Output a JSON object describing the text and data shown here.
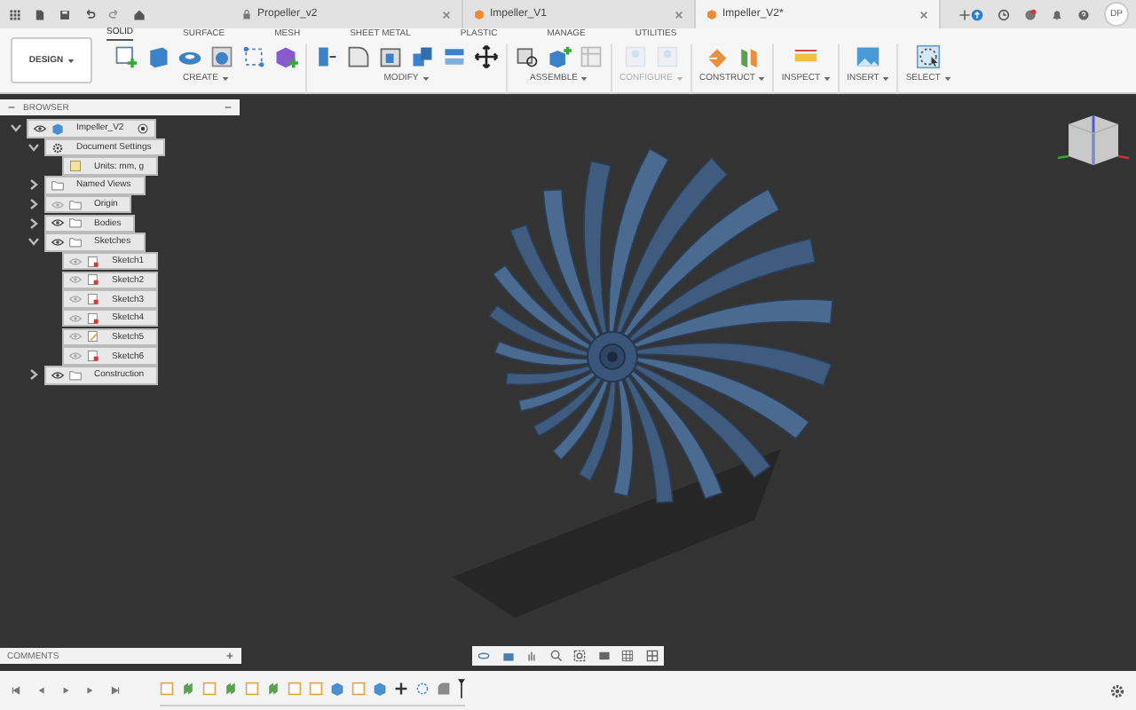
{
  "doc_tabs": [
    {
      "label": "Propeller_v2",
      "kind": "locked",
      "selected": false
    },
    {
      "label": "Impeller_V1",
      "kind": "design",
      "selected": false
    },
    {
      "label": "Impeller_V2*",
      "kind": "design",
      "selected": true
    }
  ],
  "user": {
    "initials": "DP"
  },
  "workspace": {
    "label": "DESIGN"
  },
  "toolbar_tabs": [
    {
      "label": "SOLID",
      "selected": true
    },
    {
      "label": "SURFACE",
      "selected": false
    },
    {
      "label": "MESH",
      "selected": false
    },
    {
      "label": "SHEET METAL",
      "selected": false
    },
    {
      "label": "PLASTIC",
      "selected": false
    },
    {
      "label": "MANAGE",
      "selected": false
    },
    {
      "label": "UTILITIES",
      "selected": false
    }
  ],
  "tool_groups": [
    {
      "label": "CREATE",
      "kind": "create"
    },
    {
      "label": "MODIFY",
      "kind": "modify"
    },
    {
      "label": "ASSEMBLE",
      "kind": "assemble"
    },
    {
      "label": "CONFIGURE",
      "kind": "configure",
      "disabled": true
    },
    {
      "label": "CONSTRUCT",
      "kind": "construct"
    },
    {
      "label": "INSPECT",
      "kind": "inspect"
    },
    {
      "label": "INSERT",
      "kind": "insert"
    },
    {
      "label": "SELECT",
      "kind": "select"
    }
  ],
  "browser": {
    "title": "BROWSER",
    "tree": [
      {
        "label": "Impeller_V2",
        "kind": "component",
        "expanded": true,
        "visible": true,
        "children": [
          {
            "label": "Document Settings",
            "kind": "settings",
            "expanded": true,
            "children": [
              {
                "label": "Units: mm, g",
                "kind": "units"
              }
            ]
          },
          {
            "label": "Named Views",
            "kind": "folder",
            "expanded": false
          },
          {
            "label": "Origin",
            "kind": "folder",
            "expanded": false,
            "visible": false
          },
          {
            "label": "Bodies",
            "kind": "folder",
            "expanded": false,
            "visible": true
          },
          {
            "label": "Sketches",
            "kind": "folder",
            "expanded": true,
            "visible": true,
            "children": [
              {
                "label": "Sketch1",
                "kind": "sketch",
                "visible": false
              },
              {
                "label": "Sketch2",
                "kind": "sketch",
                "visible": false
              },
              {
                "label": "Sketch3",
                "kind": "sketch",
                "visible": false
              },
              {
                "label": "Sketch4",
                "kind": "sketch",
                "visible": false
              },
              {
                "label": "Sketch5",
                "kind": "sketch-open",
                "visible": false
              },
              {
                "label": "Sketch6",
                "kind": "sketch",
                "visible": false
              }
            ]
          },
          {
            "label": "Construction",
            "kind": "folder",
            "expanded": false,
            "visible": true
          }
        ]
      }
    ]
  },
  "comments": {
    "title": "COMMENTS"
  },
  "timeline": {
    "features": [
      {
        "kind": "sketch"
      },
      {
        "kind": "sweep"
      },
      {
        "kind": "sketch"
      },
      {
        "kind": "sweep"
      },
      {
        "kind": "sketch"
      },
      {
        "kind": "sweep"
      },
      {
        "kind": "sketch"
      },
      {
        "kind": "sketch"
      },
      {
        "kind": "shell"
      },
      {
        "kind": "sketch"
      },
      {
        "kind": "extrude"
      },
      {
        "kind": "move"
      },
      {
        "kind": "pattern"
      },
      {
        "kind": "fillet"
      }
    ]
  }
}
